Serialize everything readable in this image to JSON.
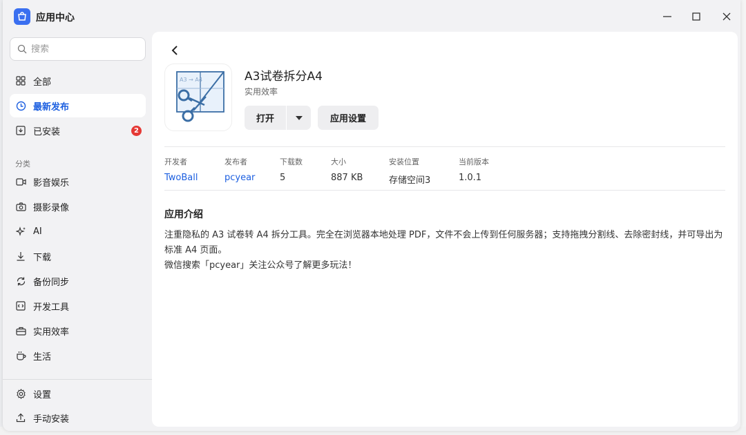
{
  "window": {
    "title": "应用中心"
  },
  "sidebar": {
    "search_placeholder": "搜索",
    "items": [
      {
        "label": "全部",
        "icon": "grid-icon",
        "active": false
      },
      {
        "label": "最新发布",
        "icon": "clock-icon",
        "active": true
      },
      {
        "label": "已安装",
        "icon": "installed-box-icon",
        "active": false,
        "badge": "2"
      }
    ],
    "category_label": "分类",
    "categories": [
      {
        "label": "影音娱乐",
        "icon": "video-icon"
      },
      {
        "label": "摄影录像",
        "icon": "camera-icon"
      },
      {
        "label": "AI",
        "icon": "sparkle-icon"
      },
      {
        "label": "下载",
        "icon": "download-icon"
      },
      {
        "label": "备份同步",
        "icon": "sync-icon"
      },
      {
        "label": "开发工具",
        "icon": "code-icon"
      },
      {
        "label": "实用效率",
        "icon": "toolbox-icon"
      },
      {
        "label": "生活",
        "icon": "cup-icon"
      }
    ],
    "footer": [
      {
        "label": "设置",
        "icon": "gear-icon"
      },
      {
        "label": "手动安装",
        "icon": "upload-icon"
      }
    ]
  },
  "app": {
    "name": "A3试卷拆分A4",
    "category": "实用效率",
    "icon_text": "A3 → A4",
    "open_label": "打开",
    "settings_label": "应用设置",
    "meta": [
      {
        "label": "开发者",
        "value": "TwoBall",
        "link": true
      },
      {
        "label": "发布者",
        "value": "pcyear",
        "link": true
      },
      {
        "label": "下载数",
        "value": "5",
        "link": false
      },
      {
        "label": "大小",
        "value": "887 KB",
        "link": false
      },
      {
        "label": "安装位置",
        "value": "存储空间3",
        "link": false
      },
      {
        "label": "当前版本",
        "value": "1.0.1",
        "link": false
      }
    ],
    "intro_title": "应用介绍",
    "intro_lines": [
      "注重隐私的 A3 试卷转 A4 拆分工具。完全在浏览器本地处理 PDF，文件不会上传到任何服务器；支持拖拽分割线、去除密封线，并可导出为标准 A4 页面。",
      "微信搜索「pcyear」关注公众号了解更多玩法！"
    ]
  },
  "colors": {
    "accent": "#1c5fe0",
    "badge": "#e53935",
    "sidebar_bg": "#f2f2f4",
    "logo_bg": "#3a6ff0"
  }
}
